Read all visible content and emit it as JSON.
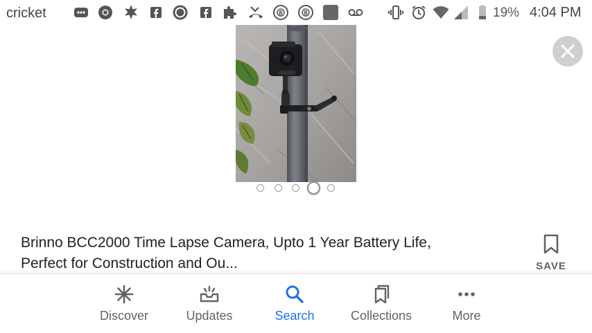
{
  "status_bar": {
    "carrier": "cricket",
    "battery_percent": "19%",
    "time": "4:04 PM",
    "icons": [
      "messages-icon",
      "chrome-icon",
      "star-badge-icon",
      "facebook-icon",
      "poker-chip-icon",
      "facebook-icon",
      "puzzle-icon",
      "missed-call-icon",
      "eight-ball-icon",
      "eight-ball-icon",
      "app-square-icon",
      "voicemail-icon",
      "vibrate-icon",
      "alarm-icon",
      "wifi-icon",
      "signal-icon",
      "battery-icon"
    ]
  },
  "gallery": {
    "image_subject": "camera-mounted-on-pole",
    "image_count": 5,
    "active_index": 3
  },
  "product": {
    "title_line1": "Brinno BCC2000 Time Lapse Camera, Upto 1 Year Battery Life,",
    "title_line2": "Perfect for Construction and Ou..."
  },
  "save": {
    "label": "SAVE"
  },
  "nav": {
    "items": [
      {
        "label": "Discover",
        "icon": "asterisk-icon"
      },
      {
        "label": "Updates",
        "icon": "updates-tray-icon"
      },
      {
        "label": "Search",
        "icon": "search-icon"
      },
      {
        "label": "Collections",
        "icon": "collections-bookmark-icon"
      },
      {
        "label": "More",
        "icon": "more-dots-icon"
      }
    ],
    "active": "Search"
  },
  "colors": {
    "accent": "#1a73e8",
    "nav_inactive": "#5f6368"
  }
}
